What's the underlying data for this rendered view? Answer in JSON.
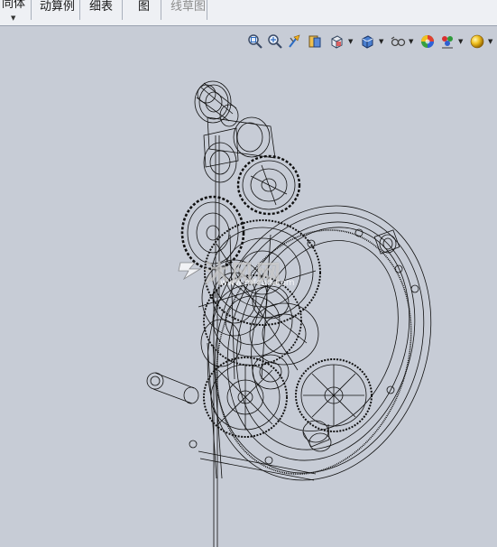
{
  "menubar": {
    "items": [
      {
        "label": "同体",
        "dim": false
      },
      {
        "label": "动算例",
        "dim": false
      },
      {
        "label": "细表",
        "dim": false
      },
      {
        "label": "图",
        "dim": false
      },
      {
        "label": "线草图",
        "dim": true
      }
    ]
  },
  "toolbar": {
    "icons": [
      "zoom-to-fit-icon",
      "zoom-to-area-icon",
      "previous-view-icon",
      "section-view-icon",
      "view-orientation-icon",
      "display-style-icon",
      "hide-show-items-icon",
      "edit-appearance-icon",
      "apply-scene-icon",
      "view-settings-icon"
    ]
  },
  "watermark": {
    "cn": "沐风网",
    "en": "www.mfcad.com"
  }
}
